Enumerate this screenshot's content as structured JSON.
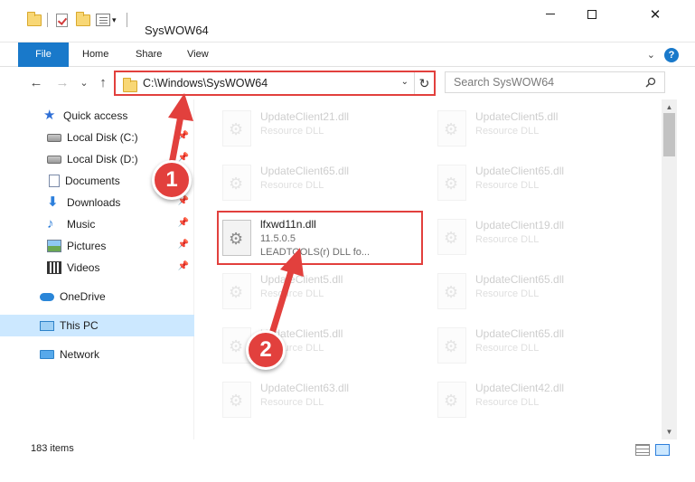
{
  "window": {
    "title": "SysWOW64",
    "minimize_label": "",
    "maximize_label": "",
    "close_label": "✕"
  },
  "ribbon": {
    "tabs": [
      "File",
      "Home",
      "Share",
      "View"
    ],
    "help_label": "?"
  },
  "navigation": {
    "back": "←",
    "forward": "→",
    "recent": "⌄",
    "up": "↑",
    "address": "C:\\Windows\\SysWOW64",
    "refresh": "↻",
    "search_placeholder": "Search SysWOW64"
  },
  "sidebar": {
    "items": [
      {
        "label": "Quick access",
        "icon": "star-icon",
        "pinned": false
      },
      {
        "label": "Local Disk (C:)",
        "icon": "drive-icon",
        "pinned": true
      },
      {
        "label": "Local Disk (D:)",
        "icon": "drive-icon",
        "pinned": true
      },
      {
        "label": "Documents",
        "icon": "documents-icon",
        "pinned": true
      },
      {
        "label": "Downloads",
        "icon": "download-icon",
        "pinned": true
      },
      {
        "label": "Music",
        "icon": "music-icon",
        "pinned": true
      },
      {
        "label": "Pictures",
        "icon": "pictures-icon",
        "pinned": true
      },
      {
        "label": "Videos",
        "icon": "videos-icon",
        "pinned": true
      },
      {
        "label": "OneDrive",
        "icon": "cloud-icon",
        "pinned": false
      },
      {
        "label": "This PC",
        "icon": "computer-icon",
        "pinned": false,
        "selected": true
      },
      {
        "label": "Network",
        "icon": "network-icon",
        "pinned": false
      }
    ]
  },
  "files": {
    "left": [
      {
        "name": "UpdateClient21.dll",
        "type": "Resource DLL"
      },
      {
        "name": "UpdateClient65.dll",
        "type": "Resource DLL"
      },
      {
        "name": "lfxwd11n.dll",
        "version": "11.5.0.5",
        "description": "LEADTOOLS(r) DLL fo...",
        "highlighted": true
      },
      {
        "name": "UpdateClient5.dll",
        "type": "Resource DLL"
      },
      {
        "name": "UpdateClient5.dll",
        "type": "Resource DLL"
      },
      {
        "name": "UpdateClient63.dll",
        "type": "Resource DLL"
      }
    ],
    "right": [
      {
        "name": "UpdateClient5.dll",
        "type": "Resource DLL"
      },
      {
        "name": "UpdateClient65.dll",
        "type": "Resource DLL"
      },
      {
        "name": "UpdateClient19.dll",
        "type": "Resource DLL"
      },
      {
        "name": "UpdateClient65.dll",
        "type": "Resource DLL"
      },
      {
        "name": "UpdateClient65.dll",
        "type": "Resource DLL"
      },
      {
        "name": "UpdateClient42.dll",
        "type": "Resource DLL"
      }
    ]
  },
  "status": {
    "item_count": "183 items"
  },
  "callouts": [
    {
      "number": "1"
    },
    {
      "number": "2"
    }
  ],
  "colors": {
    "accent": "#1979ca",
    "callout": "#e2403d",
    "selection": "#cce8ff"
  }
}
